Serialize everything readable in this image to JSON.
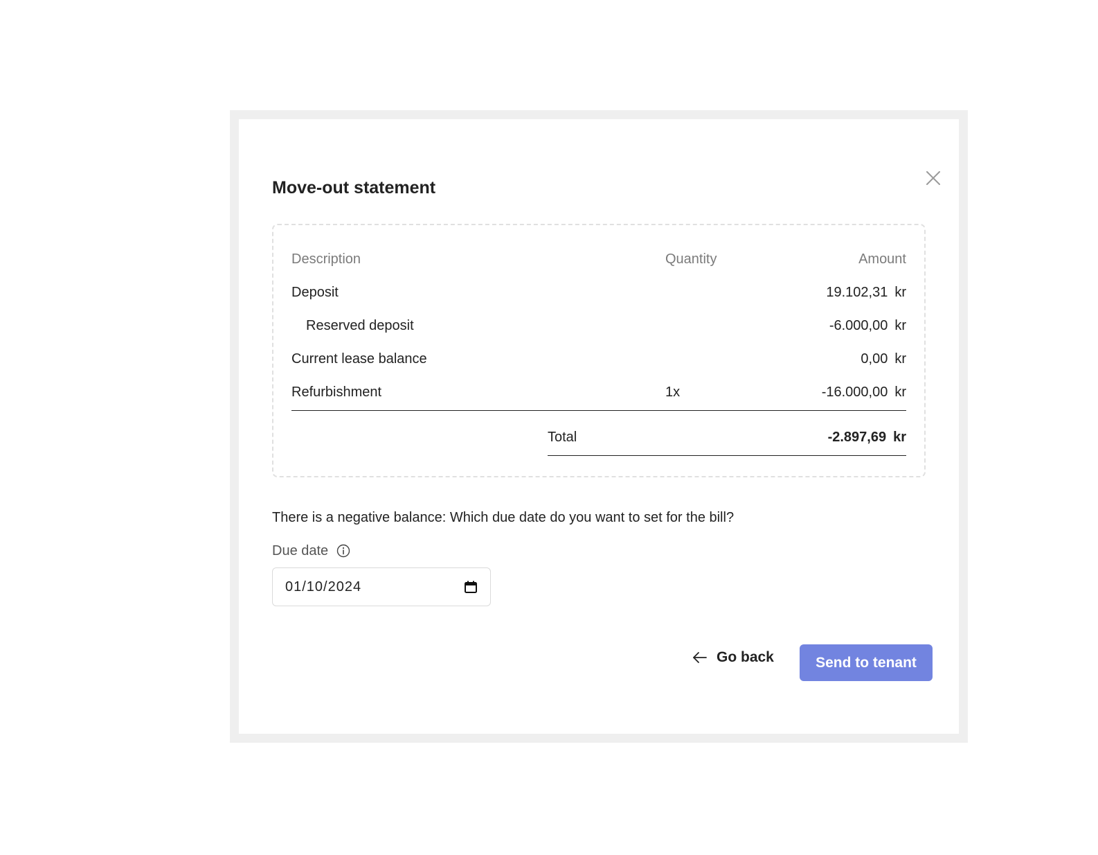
{
  "modal": {
    "title": "Move-out statement"
  },
  "statement": {
    "columns": {
      "description": "Description",
      "quantity": "Quantity",
      "amount": "Amount"
    },
    "rows": [
      {
        "description": "Deposit",
        "quantity": "",
        "amount": "19.102,31",
        "currency": "kr"
      },
      {
        "description": "Reserved deposit",
        "quantity": "",
        "amount": "-6.000,00",
        "currency": "kr"
      },
      {
        "description": "Current lease balance",
        "quantity": "",
        "amount": "0,00",
        "currency": "kr"
      },
      {
        "description": "Refurbishment",
        "quantity": "1x",
        "amount": "-16.000,00",
        "currency": "kr"
      }
    ],
    "total": {
      "label": "Total",
      "amount": "-2.897,69",
      "currency": "kr"
    }
  },
  "due": {
    "question": "There is a negative balance: Which due date do you want to set for the bill?",
    "label": "Due date",
    "value": "01/10/2024"
  },
  "actions": {
    "go_back": "Go back",
    "send": "Send to tenant"
  },
  "colors": {
    "accent": "#7284e0",
    "frame": "#efefef",
    "muted_text": "#7b7b7b"
  },
  "icons": {
    "close": "close-icon",
    "info": "info-icon",
    "calendar": "calendar-icon",
    "back": "arrow-left-icon"
  }
}
